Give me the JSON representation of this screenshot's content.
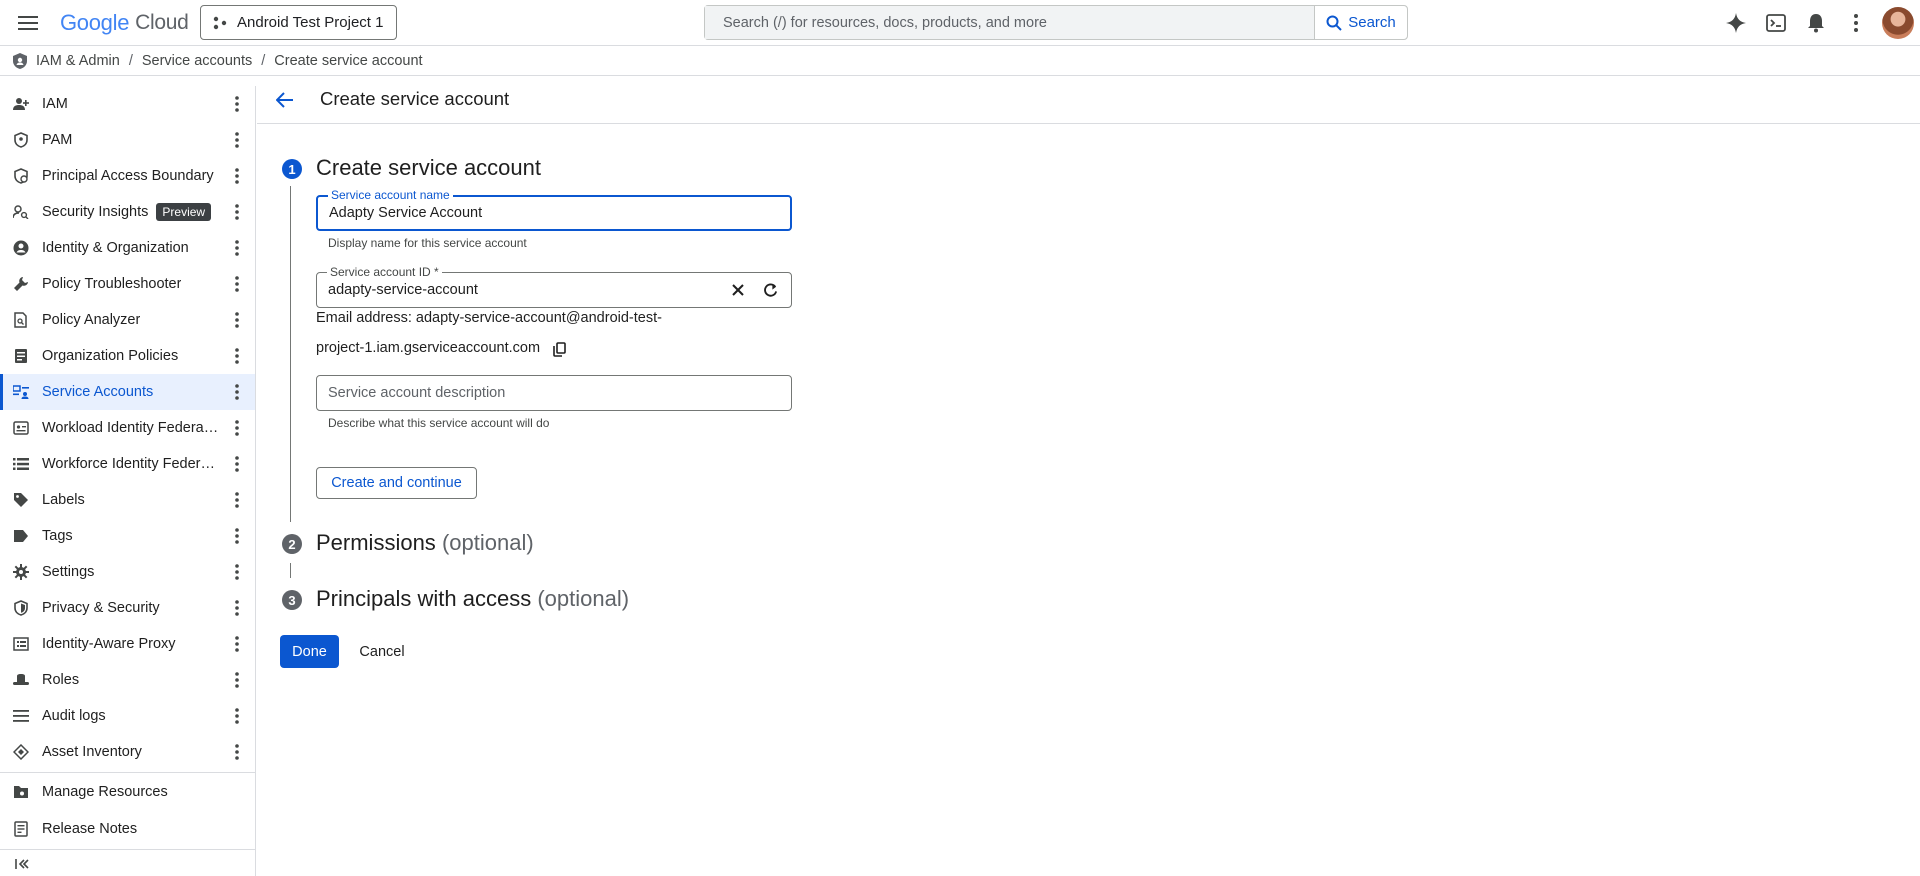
{
  "header": {
    "logo_google": "Google",
    "logo_cloud": "Cloud",
    "project_name": "Android Test Project 1",
    "search_placeholder": "Search (/) for resources, docs, products, and more",
    "search_button": "Search",
    "icons": [
      "gemini-sparkle-icon",
      "cloud-shell-icon",
      "notifications-icon",
      "more-vert-icon"
    ]
  },
  "breadcrumb": {
    "items": [
      "IAM & Admin",
      "Service accounts",
      "Create service account"
    ]
  },
  "sidebar": {
    "items": [
      {
        "label": "IAM",
        "icon": "person-add-icon"
      },
      {
        "label": "PAM",
        "icon": "shield-person-icon"
      },
      {
        "label": "Principal Access Boundary",
        "icon": "boundary-shield-icon"
      },
      {
        "label": "Security Insights",
        "icon": "person-search-icon",
        "badge": "Preview"
      },
      {
        "label": "Identity & Organization",
        "icon": "account-circle-icon"
      },
      {
        "label": "Policy Troubleshooter",
        "icon": "wrench-icon"
      },
      {
        "label": "Policy Analyzer",
        "icon": "doc-search-icon"
      },
      {
        "label": "Organization Policies",
        "icon": "list-doc-icon"
      },
      {
        "label": "Service Accounts",
        "icon": "service-account-icon",
        "active": true
      },
      {
        "label": "Workload Identity Federation",
        "icon": "id-card-icon"
      },
      {
        "label": "Workforce Identity Federation",
        "icon": "list-icon"
      },
      {
        "label": "Labels",
        "icon": "label-icon"
      },
      {
        "label": "Tags",
        "icon": "tag-icon"
      },
      {
        "label": "Settings",
        "icon": "gear-icon"
      },
      {
        "label": "Privacy & Security",
        "icon": "shield-icon"
      },
      {
        "label": "Identity-Aware Proxy",
        "icon": "iap-icon"
      },
      {
        "label": "Roles",
        "icon": "hat-icon"
      },
      {
        "label": "Audit logs",
        "icon": "lines-icon"
      },
      {
        "label": "Asset Inventory",
        "icon": "diamond-icon"
      }
    ],
    "bottom_items": [
      {
        "label": "Manage Resources",
        "icon": "folder-gear-icon"
      },
      {
        "label": "Release Notes",
        "icon": "notes-icon"
      }
    ]
  },
  "page": {
    "title": "Create service account"
  },
  "steps": [
    {
      "number": "1",
      "title": "Create service account",
      "optional": ""
    },
    {
      "number": "2",
      "title": "Permissions",
      "optional": "(optional)"
    },
    {
      "number": "3",
      "title": "Principals with access",
      "optional": "(optional)"
    }
  ],
  "form": {
    "name_label": "Service account name",
    "name_value": "Adapty Service Account",
    "name_hint": "Display name for this service account",
    "id_label": "Service account ID *",
    "id_value": "adapty-service-account",
    "email_line1": "Email address: adapty-service-account@android-test-",
    "email_line2": "project-1.iam.gserviceaccount.com",
    "description_placeholder": "Service account description",
    "description_hint": "Describe what this service account will do",
    "create_continue": "Create and continue"
  },
  "actions": {
    "done": "Done",
    "cancel": "Cancel"
  },
  "colors": {
    "primary": "#0b57d0",
    "active_bg": "#e8f0fe",
    "border": "#dadce0"
  }
}
